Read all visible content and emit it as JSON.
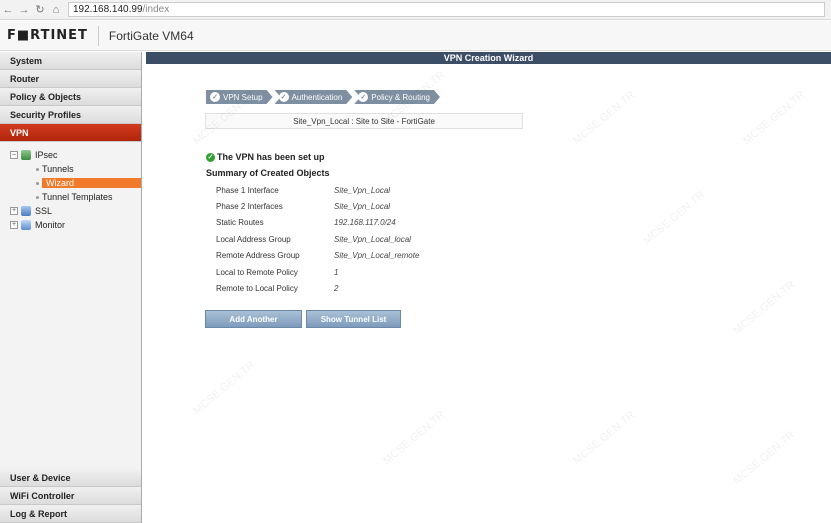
{
  "browser": {
    "url_host": "192.168.140.99",
    "url_path": "/index"
  },
  "header": {
    "logo_text": "F■RTINET",
    "product": "FortiGate VM64"
  },
  "sidebar": {
    "top_items": [
      {
        "label": "System"
      },
      {
        "label": "Router"
      },
      {
        "label": "Policy & Objects"
      },
      {
        "label": "Security Profiles"
      },
      {
        "label": "VPN"
      }
    ],
    "tree": {
      "ipsec": "IPsec",
      "tunnels": "Tunnels",
      "wizard": "Wizard",
      "tunnel_templates": "Tunnel Templates",
      "ssl": "SSL",
      "monitor": "Monitor"
    },
    "bottom_items": [
      {
        "label": "User & Device"
      },
      {
        "label": "WiFi Controller"
      },
      {
        "label": "Log & Report"
      }
    ]
  },
  "main": {
    "title": "VPN Creation Wizard",
    "steps": [
      {
        "label": "VPN Setup"
      },
      {
        "label": "Authentication"
      },
      {
        "label": "Policy & Routing"
      }
    ],
    "subtitle": "Site_Vpn_Local : Site to Site - FortiGate",
    "status": "The VPN has been set up",
    "summary_title": "Summary of Created Objects",
    "summary": [
      {
        "label": "Phase 1 Interface",
        "value": "Site_Vpn_Local"
      },
      {
        "label": "Phase 2 Interfaces",
        "value": "Site_Vpn_Local"
      },
      {
        "label": "Static Routes",
        "value": "192.168.117.0/24"
      },
      {
        "label": "Local Address Group",
        "value": "Site_Vpn_Local_local"
      },
      {
        "label": "Remote Address Group",
        "value": "Site_Vpn_Local_remote"
      },
      {
        "label": "Local to Remote Policy",
        "value": "1"
      },
      {
        "label": "Remote to Local Policy",
        "value": "2"
      }
    ],
    "buttons": {
      "add_another": "Add Another",
      "show_tunnel_list": "Show Tunnel List"
    }
  },
  "watermark": "MCSE.GEN.TR",
  "colors": {
    "accent_red": "#c8311a",
    "selected_orange": "#f07a2a",
    "title_bar": "#3c4d66",
    "button_blue": "#8fa9c6"
  }
}
